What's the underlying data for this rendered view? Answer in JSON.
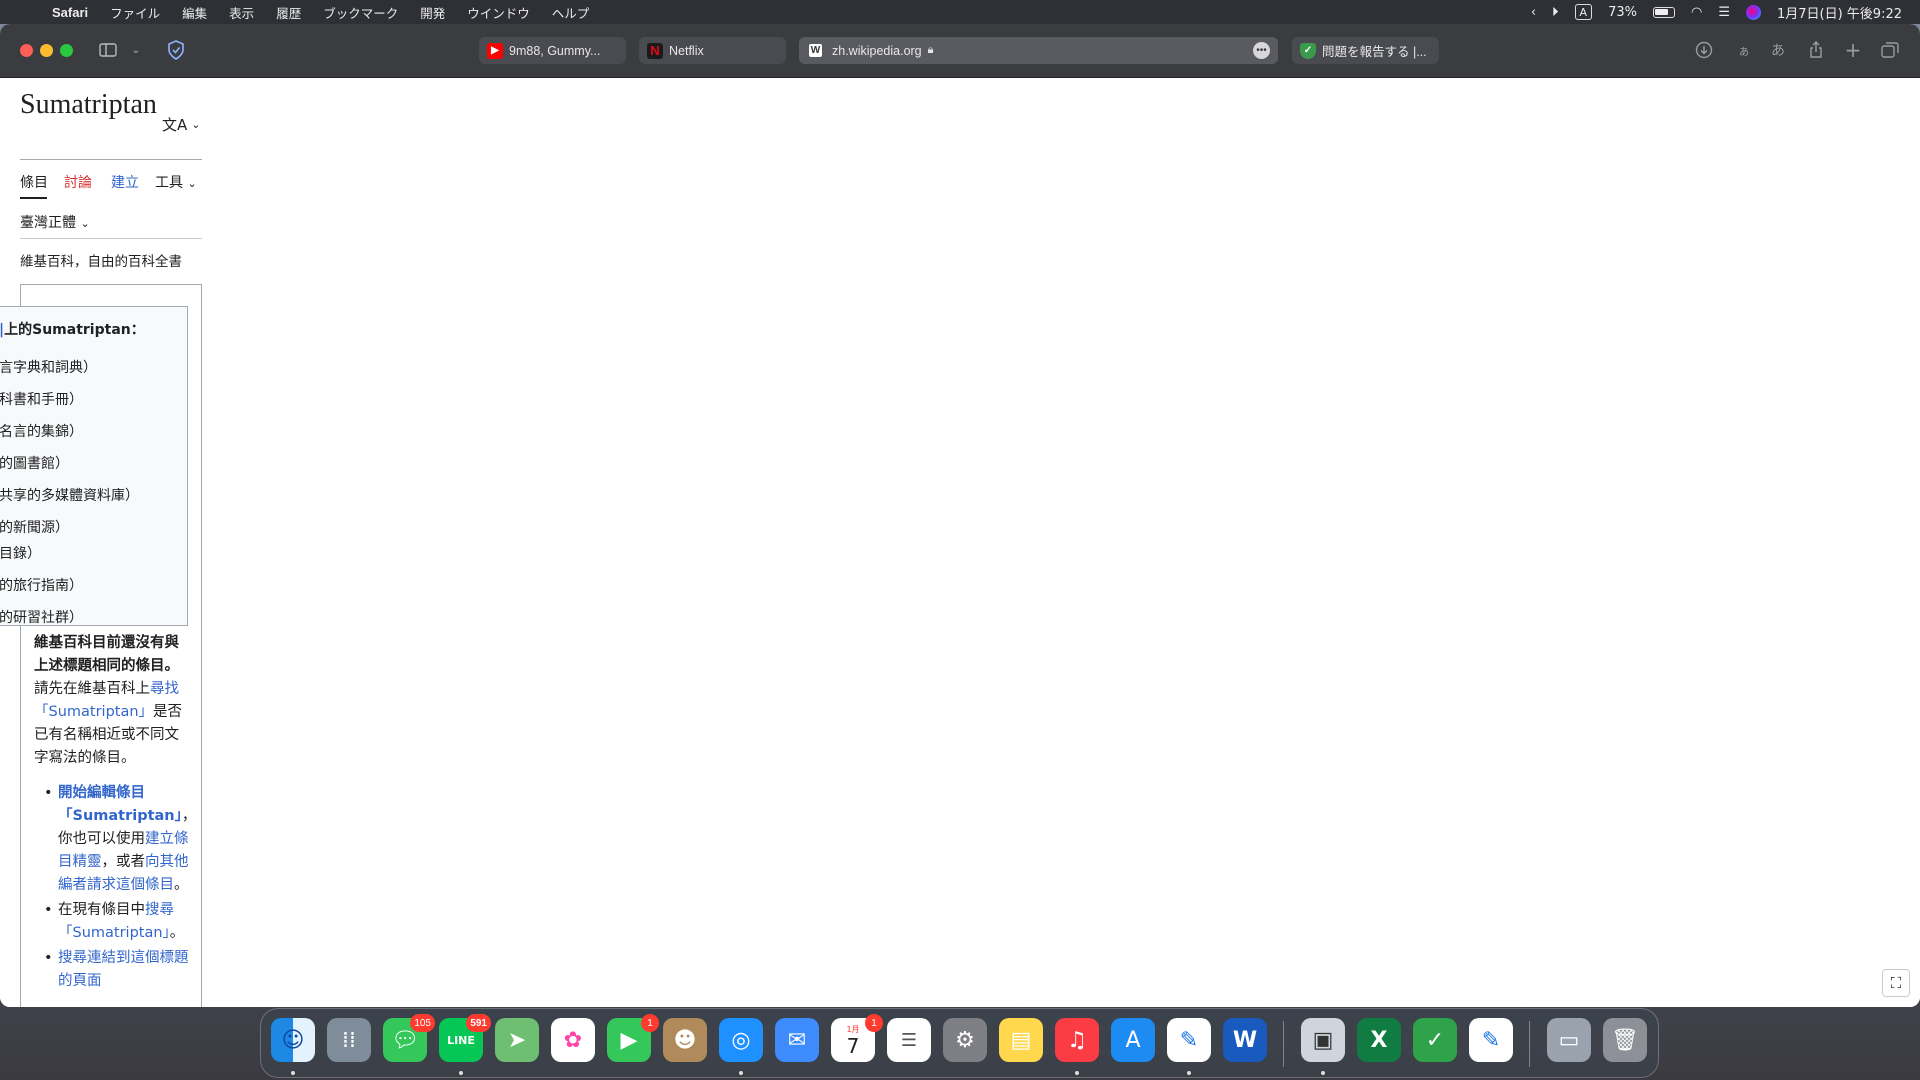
{
  "menubar": {
    "app_name": "Safari",
    "items": [
      "ファイル",
      "編集",
      "表示",
      "履歴",
      "ブックマーク",
      "開発",
      "ウインドウ",
      "ヘルプ"
    ],
    "input_indicator": "A",
    "battery_percent": "73%",
    "datetime": "1月7日(日) 午後9:22"
  },
  "browser": {
    "tabs": [
      {
        "label": "9m88, Gummy...",
        "favicon": "youtube-icon"
      },
      {
        "label": "Netflix",
        "favicon": "netflix-icon"
      },
      {
        "label": "zh.wikipedia.org",
        "favicon": "wikipedia-icon",
        "active": true
      },
      {
        "label": "問題を報告する |...",
        "favicon": "shield-icon"
      }
    ],
    "toolbar_glyphs": {
      "hiragana_small": "ぁ",
      "hiragana": "あ"
    }
  },
  "page": {
    "title": "Sumatriptan",
    "tabs": {
      "article": "條目",
      "talk": "討論",
      "create": "建立",
      "tools": "工具"
    },
    "variant": "臺灣正體",
    "tagline": "維基百科，自由的百科全書",
    "sister_projects": {
      "heading": "上的Sumatriptan：",
      "lines": [
        "言字典和詞典）",
        "科書和手冊）",
        "名言的集錦）",
        "的圖書館）",
        "共享的多媒體資料庫）",
        "的新聞源）",
        "目錄）",
        "的旅行指南）",
        "的研習社群）"
      ]
    },
    "notice": {
      "bold_text": "維基百科目前還沒有與上述標題相同的條目。",
      "text1": "請先在維基百科上",
      "search_link": "尋找「Sumatriptan」",
      "text2": "是否已有名稱相近或不同文字寫法的條目。",
      "bullets": {
        "b1_link": "開始編輯條目「Sumatriptan」",
        "b1_text": "，你也可以使用",
        "b1_link2": "建立條目精靈",
        "b1_text2": "，或者",
        "b1_link3": "向其他編者請求這個條目",
        "b1_end": "。",
        "b2_text": "在現有條目中",
        "b2_link": "搜尋「Sumatriptan」",
        "b2_end": "。",
        "b3_link": "搜尋連結到這個標題的頁面"
      }
    }
  },
  "dock": {
    "badges": {
      "messages": "105",
      "line": "591",
      "facetime": "1",
      "calendar": "1"
    },
    "calendar": {
      "month": "1月",
      "day": "7"
    }
  }
}
